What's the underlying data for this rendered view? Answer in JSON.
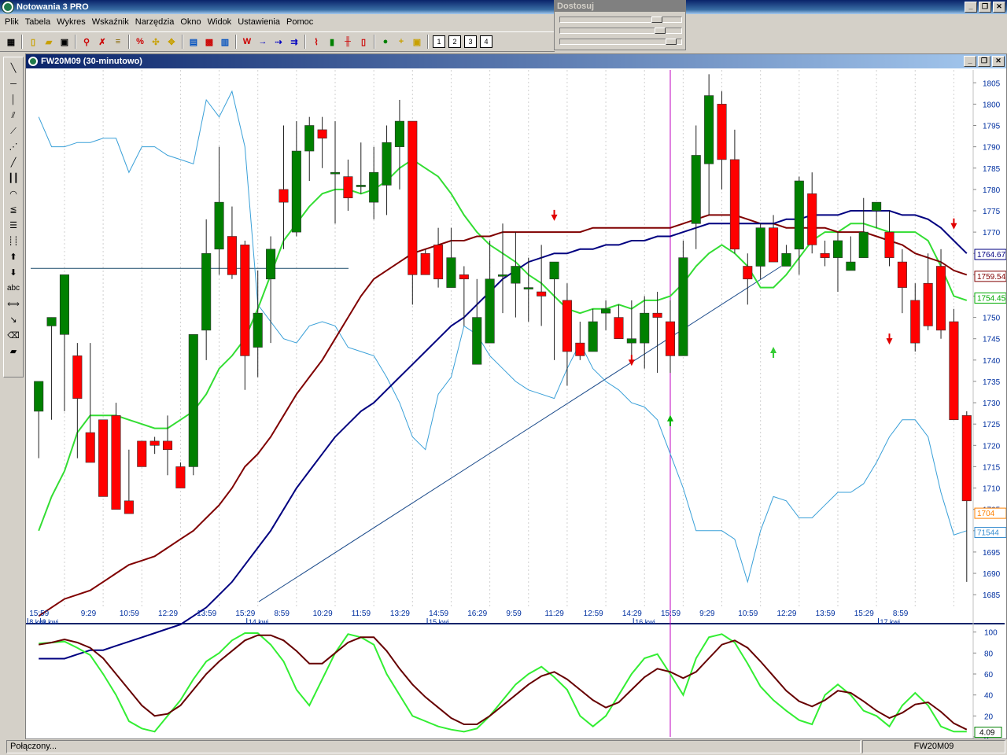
{
  "app": {
    "title": "Notowania 3 PRO"
  },
  "menu": [
    "Plik",
    "Tabela",
    "Wykres",
    "Wskaźnik",
    "Narzędzia",
    "Okno",
    "Widok",
    "Ustawienia",
    "Pomoc"
  ],
  "toolbar": {
    "pages": [
      "1",
      "2",
      "3",
      "4"
    ]
  },
  "dostosuj": {
    "title": "Dostosuj",
    "levels": [
      0.8,
      0.8,
      0.9
    ]
  },
  "chart_window": {
    "title": "FW20M09 (30-minutowo)"
  },
  "status": {
    "left": "Połączony...",
    "right": "FW20M09"
  },
  "chart_data": [
    {
      "type": "candlestick",
      "title": "FW20M09 (30-minutowo)",
      "ylim": [
        1683,
        1808
      ],
      "y_ticks": [
        1685,
        1690,
        1695,
        1700,
        1705,
        1710,
        1715,
        1720,
        1725,
        1730,
        1735,
        1740,
        1745,
        1750,
        1755,
        1760,
        1765,
        1770,
        1775,
        1780,
        1785,
        1790,
        1795,
        1800,
        1805
      ],
      "time_labels": [
        "15:59",
        "9:29",
        "10:59",
        "12:29",
        "13:59",
        "15:29",
        "8:59",
        "10:29",
        "11:59",
        "13:29",
        "14:59",
        "16:29",
        "9:59",
        "11:29",
        "12:59",
        "14:29",
        "15:59",
        "9:29",
        "10:59",
        "12:29",
        "13:59",
        "15:29",
        "8:59"
      ],
      "date_labels": [
        "8 kwi",
        "9 kwi",
        "14 kwi",
        "15 kwi",
        "16 kwi",
        "17 kwi"
      ],
      "price_badges": [
        {
          "label": "1764.67",
          "value": 1764.67,
          "color": "#000080"
        },
        {
          "label": "1759.54",
          "value": 1759.54,
          "color": "#800000"
        },
        {
          "label": "1754.45",
          "value": 1754.45,
          "color": "#00aa00"
        },
        {
          "label": "1704",
          "value": 1704,
          "color": "#ff8000"
        },
        {
          "label": "71544",
          "value": 1699.5,
          "color": "#3a8fd0"
        }
      ],
      "candles": [
        [
          1728,
          1735,
          1717,
          1721
        ],
        [
          1748,
          1750,
          1726,
          1743
        ],
        [
          1746,
          1760,
          1728,
          1722
        ],
        [
          1741,
          1731,
          1717,
          1744
        ],
        [
          1723,
          1716,
          1735,
          1744
        ],
        [
          1726,
          1708,
          1727,
          1726
        ],
        [
          1727,
          1705,
          1705,
          1730
        ],
        [
          1707,
          1704,
          1705,
          1719
        ],
        [
          1721,
          1715,
          1726,
          1721
        ],
        [
          1721,
          1720,
          1718,
          1722
        ],
        [
          1721,
          1719,
          1713,
          1727
        ],
        [
          1715,
          1710,
          1712,
          1716
        ],
        [
          1715,
          1746,
          1713,
          1746
        ],
        [
          1747,
          1765,
          1740,
          1773
        ],
        [
          1766,
          1777,
          1760,
          1790
        ],
        [
          1769,
          1760,
          1759,
          1776
        ],
        [
          1767,
          1741,
          1733,
          1768
        ],
        [
          1743,
          1751,
          1736,
          1761
        ],
        [
          1759,
          1766,
          1744,
          1769
        ],
        [
          1780,
          1777,
          1766,
          1795
        ],
        [
          1770,
          1789,
          1769,
          1796
        ],
        [
          1789,
          1795,
          1782,
          1797
        ],
        [
          1794,
          1792,
          1785,
          1797
        ],
        [
          1784,
          1784,
          1772,
          1796
        ],
        [
          1783,
          1778,
          1775,
          1787
        ],
        [
          1781,
          1781,
          1779,
          1791
        ],
        [
          1777,
          1784,
          1773,
          1790
        ],
        [
          1781,
          1791,
          1774,
          1795
        ],
        [
          1790,
          1796,
          1780,
          1801
        ],
        [
          1796,
          1760,
          1753,
          1796
        ],
        [
          1765,
          1760,
          1761,
          1766
        ],
        [
          1767,
          1759,
          1757,
          1771
        ],
        [
          1757,
          1764,
          1758,
          1771
        ],
        [
          1760,
          1759,
          1748,
          1762
        ],
        [
          1739,
          1750,
          1742,
          1759
        ],
        [
          1744,
          1759,
          1744,
          1768
        ],
        [
          1760,
          1760,
          1751,
          1772
        ],
        [
          1758,
          1762,
          1750,
          1770
        ],
        [
          1757,
          1757,
          1749,
          1764
        ],
        [
          1756,
          1755,
          1748,
          1767
        ],
        [
          1759,
          1763,
          1740,
          1762
        ],
        [
          1754,
          1742,
          1734,
          1758
        ],
        [
          1744,
          1741,
          1740,
          1749
        ],
        [
          1742,
          1749,
          1742,
          1752
        ],
        [
          1751,
          1752,
          1747,
          1754
        ],
        [
          1750,
          1745,
          1745,
          1753
        ],
        [
          1744,
          1745,
          1741,
          1754
        ],
        [
          1744,
          1751,
          1738,
          1755
        ],
        [
          1751,
          1750,
          1737,
          1756
        ],
        [
          1749,
          1741,
          1737,
          1754
        ],
        [
          1741,
          1764,
          1741,
          1768
        ],
        [
          1772,
          1788,
          1766,
          1795
        ],
        [
          1786,
          1802,
          1774,
          1807
        ],
        [
          1800,
          1787,
          1780,
          1803
        ],
        [
          1787,
          1766,
          1765,
          1794
        ],
        [
          1762,
          1759,
          1753,
          1765
        ],
        [
          1762,
          1771,
          1759,
          1772
        ],
        [
          1771,
          1763,
          1763,
          1774
        ],
        [
          1762,
          1765,
          1763,
          1767
        ],
        [
          1766,
          1782,
          1760,
          1783
        ],
        [
          1779,
          1767,
          1765,
          1784
        ],
        [
          1765,
          1764,
          1762,
          1768
        ],
        [
          1764,
          1768,
          1756,
          1770
        ],
        [
          1761,
          1763,
          1762,
          1769
        ],
        [
          1764,
          1770,
          1765,
          1778
        ],
        [
          1775,
          1777,
          1771,
          1776
        ],
        [
          1770,
          1764,
          1762,
          1775
        ],
        [
          1763,
          1757,
          1751,
          1766
        ],
        [
          1754,
          1744,
          1742,
          1758
        ],
        [
          1758,
          1748,
          1747,
          1765
        ],
        [
          1762,
          1747,
          1745,
          1766
        ],
        [
          1749,
          1726,
          1728,
          1752
        ],
        [
          1727,
          1707,
          1688,
          1728
        ]
      ],
      "moving_averages": [
        {
          "color": "#33dd33",
          "values": [
            1700,
            1708,
            1714,
            1723,
            1727,
            1727,
            1727,
            1726,
            1725,
            1724,
            1724,
            1726,
            1728,
            1732,
            1738,
            1741,
            1745,
            1752,
            1760,
            1768,
            1772,
            1776,
            1779,
            1780,
            1780,
            1779,
            1780,
            1782,
            1785,
            1787,
            1785,
            1783,
            1779,
            1774,
            1770,
            1767,
            1765,
            1763,
            1760,
            1758,
            1755,
            1752,
            1751,
            1752,
            1752,
            1753,
            1752,
            1754,
            1754,
            1755,
            1758,
            1762,
            1765,
            1767,
            1765,
            1762,
            1757,
            1757,
            1760,
            1764,
            1768,
            1770,
            1770,
            1772,
            1772,
            1771,
            1770,
            1770,
            1770,
            1768,
            1762,
            1755,
            1754
          ]
        },
        {
          "color": "#800000",
          "values": [
            1680,
            1682,
            1684,
            1685,
            1686,
            1688,
            1690,
            1692,
            1693,
            1694,
            1696,
            1698,
            1700,
            1703,
            1706,
            1710,
            1715,
            1718,
            1722,
            1727,
            1732,
            1736,
            1740,
            1745,
            1750,
            1755,
            1759,
            1761,
            1763,
            1765,
            1766,
            1767,
            1768,
            1768,
            1769,
            1769,
            1770,
            1770,
            1770,
            1770,
            1770,
            1770,
            1770,
            1771,
            1771,
            1771,
            1771,
            1771,
            1771,
            1771,
            1772,
            1773,
            1774,
            1774,
            1774,
            1773,
            1772,
            1772,
            1771,
            1771,
            1771,
            1771,
            1770,
            1770,
            1770,
            1769,
            1768,
            1767,
            1765,
            1764,
            1763,
            1761,
            1760
          ]
        },
        {
          "color": "#000080",
          "values": [
            1670,
            1670,
            1670,
            1671,
            1672,
            1672,
            1673,
            1674,
            1675,
            1676,
            1677,
            1678,
            1680,
            1682,
            1685,
            1688,
            1692,
            1696,
            1700,
            1705,
            1710,
            1714,
            1718,
            1722,
            1725,
            1728,
            1730,
            1733,
            1736,
            1739,
            1742,
            1745,
            1748,
            1750,
            1753,
            1756,
            1759,
            1761,
            1763,
            1764,
            1765,
            1765,
            1766,
            1766,
            1767,
            1767,
            1768,
            1768,
            1769,
            1769,
            1770,
            1771,
            1772,
            1772,
            1772,
            1772,
            1772,
            1772,
            1773,
            1773,
            1774,
            1774,
            1774,
            1775,
            1775,
            1775,
            1775,
            1774,
            1774,
            1773,
            1771,
            1768,
            1765
          ]
        }
      ]
    },
    {
      "type": "line",
      "ylim": [
        0,
        105
      ],
      "y_ticks": [
        0,
        20,
        40,
        60,
        80,
        100
      ],
      "last_value_label": "4.09",
      "series": [
        {
          "color": "#33ee33",
          "values": [
            89,
            90,
            91,
            85,
            78,
            60,
            40,
            15,
            8,
            5,
            20,
            35,
            55,
            72,
            80,
            92,
            99,
            99,
            88,
            72,
            45,
            30,
            55,
            80,
            98,
            95,
            88,
            60,
            40,
            20,
            15,
            10,
            7,
            5,
            8,
            20,
            35,
            50,
            60,
            67,
            57,
            45,
            20,
            10,
            20,
            40,
            60,
            75,
            79,
            60,
            40,
            75,
            95,
            98,
            90,
            70,
            48,
            35,
            25,
            16,
            12,
            40,
            50,
            40,
            25,
            20,
            10,
            30,
            42,
            30,
            10,
            5,
            5
          ]
        },
        {
          "color": "#660000",
          "values": [
            88,
            90,
            93,
            90,
            85,
            75,
            60,
            45,
            30,
            20,
            22,
            30,
            45,
            60,
            72,
            82,
            92,
            97,
            97,
            92,
            82,
            70,
            70,
            80,
            90,
            95,
            95,
            82,
            65,
            50,
            38,
            28,
            18,
            12,
            12,
            20,
            30,
            40,
            50,
            58,
            62,
            55,
            45,
            35,
            28,
            33,
            45,
            57,
            65,
            62,
            56,
            62,
            75,
            88,
            92,
            85,
            72,
            58,
            44,
            34,
            29,
            35,
            44,
            42,
            34,
            25,
            18,
            23,
            31,
            33,
            24,
            13,
            7
          ]
        }
      ]
    }
  ]
}
